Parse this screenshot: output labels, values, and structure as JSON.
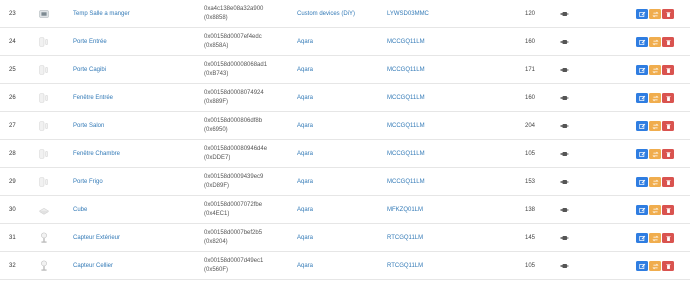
{
  "colors": {
    "link": "#337ab7",
    "edit": "#2f7de1",
    "rename": "#f0ad4e",
    "delete": "#d9534f"
  },
  "rows": [
    {
      "id": "23",
      "name": "Temp Salle a manger",
      "ieee": "0xa4c138e08a32a900",
      "nwk": "(0x8858)",
      "vendor": "Custom devices (DiY)",
      "model": "LYWSD03MMC",
      "lqi": "120",
      "image": "temp-sensor-icon"
    },
    {
      "id": "24",
      "name": "Porte Entrée",
      "ieee": "0x00158d0007ef4edc",
      "nwk": "(0x858A)",
      "vendor": "Aqara",
      "model": "MCCGQ11LM",
      "lqi": "160",
      "image": "door-sensor-icon"
    },
    {
      "id": "25",
      "name": "Porte Cagibi",
      "ieee": "0x00158d00008068ad1",
      "nwk": "(0xB743)",
      "vendor": "Aqara",
      "model": "MCCGQ11LM",
      "lqi": "171",
      "image": "door-sensor-icon"
    },
    {
      "id": "26",
      "name": "Fenêtre Entrée",
      "ieee": "0x00158d0008074924",
      "nwk": "(0x889F)",
      "vendor": "Aqara",
      "model": "MCCGQ11LM",
      "lqi": "160",
      "image": "door-sensor-icon"
    },
    {
      "id": "27",
      "name": "Porte Salon",
      "ieee": "0x00158d000806df8b",
      "nwk": "(0x6950)",
      "vendor": "Aqara",
      "model": "MCCGQ11LM",
      "lqi": "204",
      "image": "door-sensor-icon"
    },
    {
      "id": "28",
      "name": "Fenêtre Chambre",
      "ieee": "0x00158d00080946d4e",
      "nwk": "(0xDDE7)",
      "vendor": "Aqara",
      "model": "MCCGQ11LM",
      "lqi": "105",
      "image": "door-sensor-icon"
    },
    {
      "id": "29",
      "name": "Porte Frigo",
      "ieee": "0x00158d0009439ec9",
      "nwk": "(0xD89F)",
      "vendor": "Aqara",
      "model": "MCCGQ11LM",
      "lqi": "153",
      "image": "door-sensor-icon"
    },
    {
      "id": "30",
      "name": "Cube",
      "ieee": "0x00158d0007072fbe",
      "nwk": "(0x4EC1)",
      "vendor": "Aqara",
      "model": "MFKZQ01LM",
      "lqi": "138",
      "image": "cube-icon"
    },
    {
      "id": "31",
      "name": "Capteur Extérieur",
      "ieee": "0x00158d0007bef2b5",
      "nwk": "(0x8204)",
      "vendor": "Aqara",
      "model": "RTCGQ11LM",
      "lqi": "145",
      "image": "motion-sensor-icon"
    },
    {
      "id": "32",
      "name": "Capteur Cellier",
      "ieee": "0x00158d0007d49ec1",
      "nwk": "(0x560F)",
      "vendor": "Aqara",
      "model": "RTCGQ11LM",
      "lqi": "105",
      "image": "motion-sensor-icon"
    }
  ]
}
